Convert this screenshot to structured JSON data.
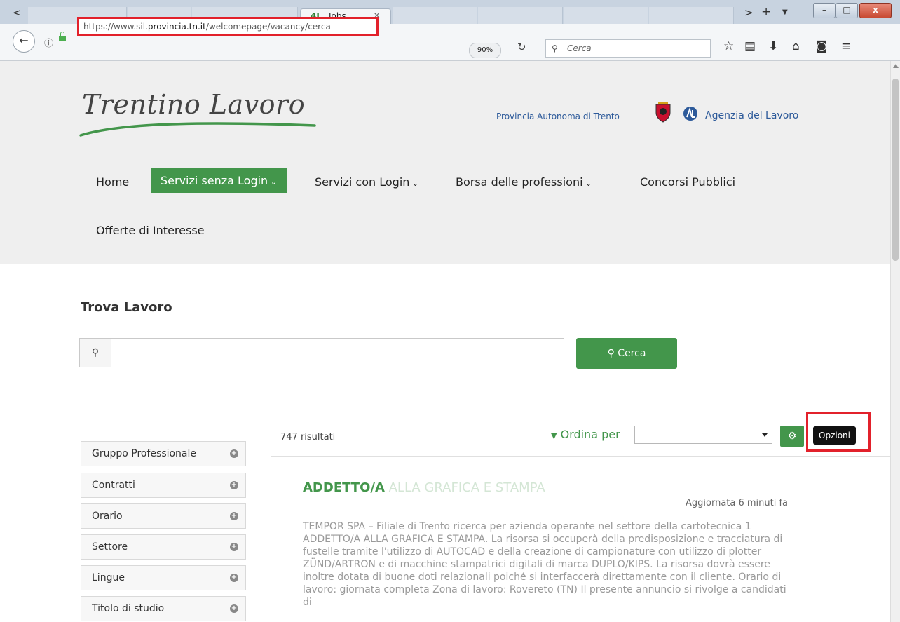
{
  "browser": {
    "tab_title": "Jobs",
    "tab_icon": "4L",
    "tab_close": "×",
    "url_prefix": "https://www.sil.",
    "url_domain": "provincia.tn.it",
    "url_path": "/welcomepage/vacancy/cerca",
    "zoom": "90%",
    "search_placeholder": "Cerca"
  },
  "header": {
    "logo": "Trentino Lavoro",
    "province": "Provincia Autonoma di Trento",
    "agency": "Agenzia del Lavoro"
  },
  "nav": {
    "home": "Home",
    "senza_login": "Servizi senza Login",
    "con_login": "Servizi con Login",
    "borsa": "Borsa delle professioni",
    "concorsi": "Concorsi Pubblici",
    "offerte": "Offerte di Interesse"
  },
  "search": {
    "title": "Trova Lavoro",
    "button": "Cerca"
  },
  "results": {
    "count": "747 risultati",
    "order_by": "Ordina per",
    "options_tooltip": "Opzioni"
  },
  "facets": [
    "Gruppo Professionale",
    "Contratti",
    "Orario",
    "Settore",
    "Lingue",
    "Titolo di studio"
  ],
  "job": {
    "title_a": "ADDETTO/A",
    "title_b": " ALLA GRAFICA E STAMPA",
    "updated": "Aggiornata 6 minuti fa",
    "description": "TEMPOR SPA – Filiale di Trento ricerca per azienda operante nel settore della cartotecnica 1 ADDETTO/A ALLA GRAFICA E STAMPA. La risorsa si occuperà della predisposizione e tracciatura di fustelle tramite l'utilizzo di AUTOCAD e della creazione di campionature con utilizzo di plotter ZÜND/ARTRON e di macchine stampatrici digitali di marca DUPLO/KIPS. La risorsa dovrà essere inoltre dotata di buone doti relazionali poiché si interfaccerà direttamente con il cliente. Orario di lavoro: giornata completa Zona di lavoro: Rovereto (TN) Il presente annuncio si rivolge a candidati di"
  },
  "colors": {
    "brand_green": "#43964b",
    "highlight_red": "#e2212b",
    "link_blue": "#2d5a9a"
  }
}
